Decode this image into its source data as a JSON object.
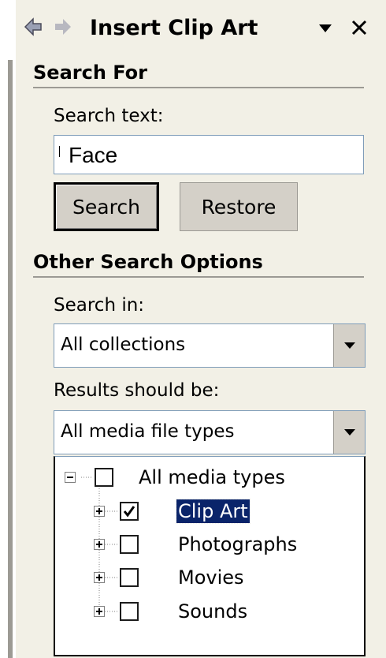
{
  "pane": {
    "title": "Insert Clip Art",
    "icons": {
      "back": "back-arrow-icon",
      "forward": "forward-arrow-icon",
      "menu": "dropdown-triangle-icon",
      "close": "close-icon"
    }
  },
  "search_for": {
    "heading": "Search For",
    "search_text_label": "Search text:",
    "search_text_value": "Face",
    "search_button": "Search",
    "restore_button": "Restore"
  },
  "other_options": {
    "heading": "Other Search Options",
    "search_in_label": "Search in:",
    "search_in_value": "All collections",
    "results_label": "Results should be:",
    "results_value": "All media file types"
  },
  "media_tree": {
    "root": {
      "label": "All media types",
      "checked": false,
      "expanded": true
    },
    "items": [
      {
        "label": "Clip Art",
        "checked": true,
        "selected": true
      },
      {
        "label": "Photographs",
        "checked": false,
        "selected": false
      },
      {
        "label": "Movies",
        "checked": false,
        "selected": false
      },
      {
        "label": "Sounds",
        "checked": false,
        "selected": false
      }
    ]
  },
  "colors": {
    "pane_background": "#f2f0e6",
    "button_face": "#d4d0c8",
    "selection": "#0a246a",
    "input_border": "#7f9db9"
  }
}
